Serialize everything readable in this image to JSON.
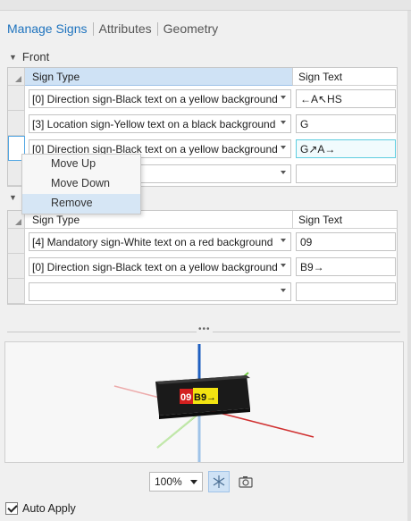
{
  "tabs": [
    {
      "label": "Manage Signs",
      "active": true
    },
    {
      "label": "Attributes",
      "active": false
    },
    {
      "label": "Geometry",
      "active": false
    }
  ],
  "front": {
    "title": "Front",
    "columns": {
      "type": "Sign Type",
      "text": "Sign Text"
    },
    "rows": [
      {
        "type": "[0] Direction sign-Black text on a yellow background",
        "text": "←A↖HS"
      },
      {
        "type": "[3] Location sign-Yellow text on a black background",
        "text": "G"
      },
      {
        "type": "[0] Direction sign-Black text on a yellow background",
        "text": "G↗A→"
      },
      {
        "type": "",
        "text": ""
      }
    ]
  },
  "back": {
    "columns": {
      "type": "Sign Type",
      "text": "Sign Text"
    },
    "rows": [
      {
        "type": "[4] Mandatory sign-White text on a red background",
        "text": "09"
      },
      {
        "type": "[0] Direction sign-Black text on a yellow background",
        "text": "B9→"
      },
      {
        "type": "",
        "text": ""
      }
    ]
  },
  "context_menu": {
    "items": [
      {
        "label": "Move Up"
      },
      {
        "label": "Move Down"
      },
      {
        "label": "Remove",
        "highlighted": true
      }
    ]
  },
  "preview": {
    "panels": [
      {
        "text": "09",
        "bg": "#d3201f",
        "fg": "#ffffff"
      },
      {
        "text": "B9→",
        "bg": "#f2e311",
        "fg": "#111111"
      }
    ],
    "axis_colors": {
      "x": "#d03030",
      "y": "#6cc83a",
      "z": "#2060c0"
    }
  },
  "toolbar": {
    "zoom": "100%",
    "icons": [
      "axes-toggle-icon",
      "camera-icon"
    ]
  },
  "footer": {
    "auto_apply_label": "Auto Apply",
    "auto_apply_checked": true
  }
}
